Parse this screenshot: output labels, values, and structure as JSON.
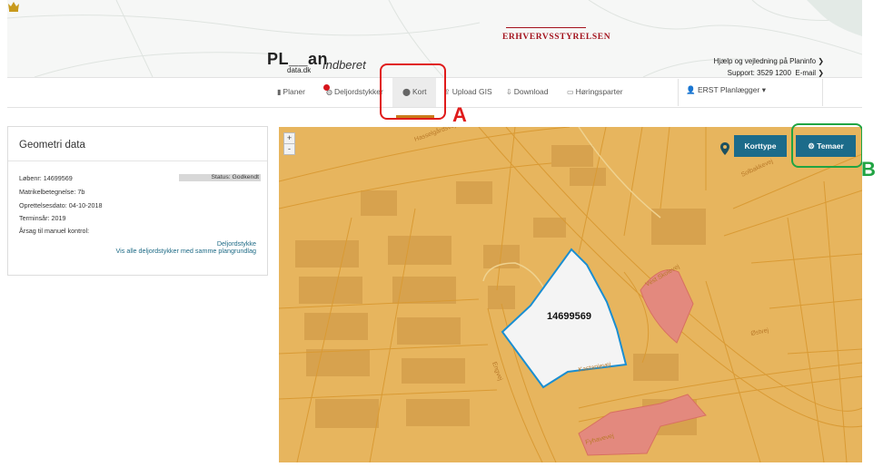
{
  "header": {
    "brand": "ERHVERVSSTYRELSEN",
    "logo_main": "PL__an",
    "logo_sub": "data.dk",
    "portal": "Indberet",
    "help_line1": "Hjælp og vejledning på Planinfo",
    "support_label": "Support: 3529 1200",
    "email_label": "E-mail"
  },
  "nav": {
    "items": [
      {
        "label": "Planer",
        "icon": "document-icon"
      },
      {
        "label": "Deljordstykker",
        "icon": "globe-icon"
      },
      {
        "label": "Kort",
        "icon": "map-marker-icon"
      },
      {
        "label": "Upload GIS",
        "icon": "upload-icon"
      },
      {
        "label": "Download",
        "icon": "download-icon"
      },
      {
        "label": "Høringsparter",
        "icon": "id-card-icon"
      }
    ],
    "active": "Kort",
    "user": "ERST Planlægger"
  },
  "panel": {
    "title": "Geometri data",
    "loebenr": "Løbenr: 14699569",
    "status": "Status: Godkendt",
    "matrikel": "Matrikelbetegnelse: 7b",
    "oprettet": "Oprettelsesdato: 04-10-2018",
    "terminsaar": "Terminsår: 2019",
    "aarsag": "Årsag til manuel kontrol:",
    "link1": "Deljordstykke",
    "link2": "Vis alle deljordstykker med samme plangrundlag"
  },
  "map": {
    "zoom_in": "+",
    "zoom_out": "-",
    "korttype": "Korttype",
    "temaer": "Temaer",
    "parcel_label": "14699569",
    "streets": [
      "Vest Skolevej",
      "Kastanievej",
      "Fyhavevej",
      "Hasselgårdsvej",
      "Solbakkevej",
      "Østvej",
      "Engvej"
    ]
  },
  "annotations": {
    "a": "A",
    "b": "B"
  },
  "colors": {
    "map_fill": "#e7b55e",
    "map_lines": "#d99a34",
    "parcel_highlight": "#1a8ed1",
    "red_zone": "#e3897e",
    "button": "#1c6b8a",
    "annot_a": "#e01b1b",
    "annot_b": "#21a443"
  }
}
